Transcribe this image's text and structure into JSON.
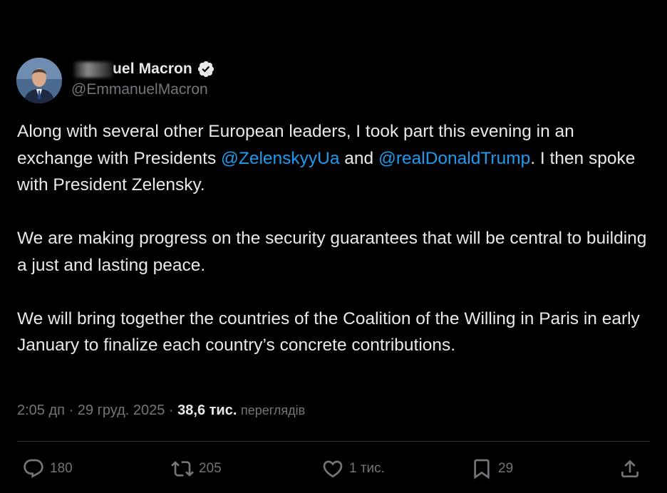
{
  "author": {
    "display_name": "uel Macron",
    "handle": "@EmmanuelMacron",
    "verified_color": "#e7e9ea"
  },
  "tweet": {
    "paragraph1": {
      "before": "Along with several other European leaders, I took part this evening in an exchange with Presidents ",
      "mention1": "@ZelenskyyUa",
      "between": " and ",
      "mention2": "@realDonaldTrump",
      "after": ". I then spoke with President Zelensky."
    },
    "paragraph2": "We are making progress on the security guarantees that will be central to building a just and lasting peace.",
    "paragraph3": "We will bring together the countries of the Coalition of the Willing in Paris in early January to finalize each country’s concrete contributions."
  },
  "meta": {
    "time": "2:05 дп",
    "sep1": " · ",
    "date": "29 груд. 2025",
    "sep2": " · ",
    "views_count": "38,6 тис.",
    "views_label": "переглядів"
  },
  "actions": {
    "reply": {
      "icon": "reply-icon",
      "count": "180"
    },
    "retweet": {
      "icon": "retweet-icon",
      "count": "205"
    },
    "like": {
      "icon": "heart-icon",
      "count": "1 тис."
    },
    "bookmark": {
      "icon": "bookmark-icon",
      "count": "29"
    },
    "share": {
      "icon": "share-icon"
    }
  },
  "colors": {
    "background": "#000000",
    "text": "#e7e9ea",
    "secondary": "#71767b",
    "link": "#1d9bf0",
    "divider": "#2f3336"
  }
}
